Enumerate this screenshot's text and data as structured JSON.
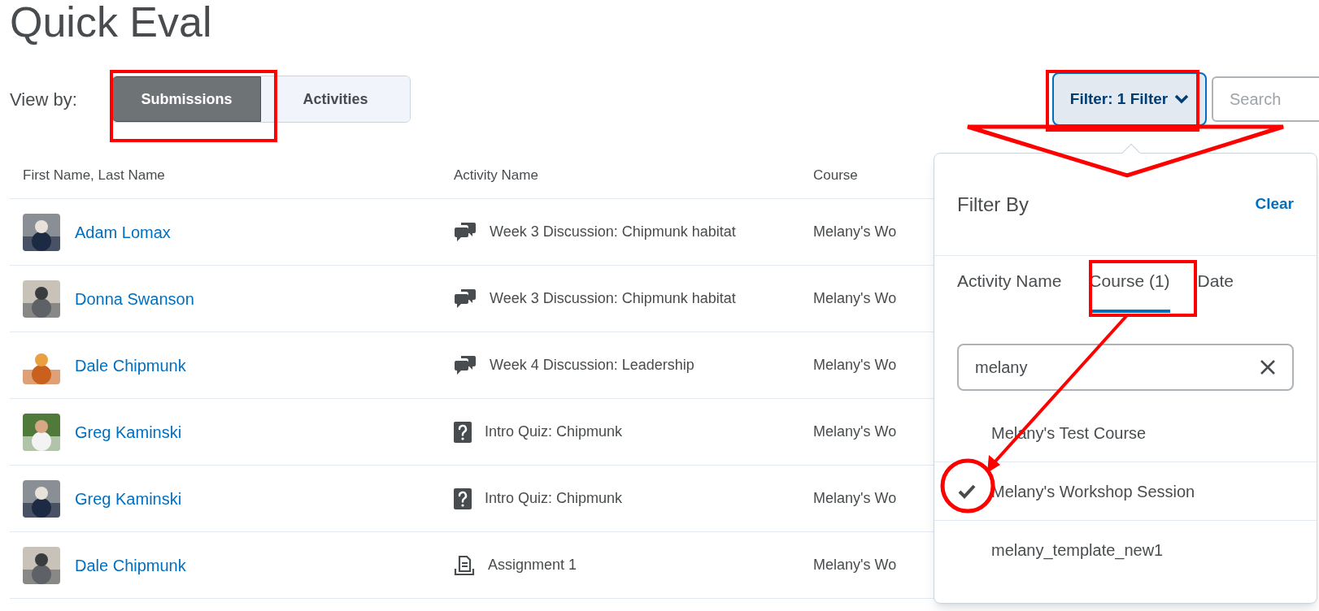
{
  "title": "Quick Eval",
  "view_by": {
    "label": "View by:",
    "options": [
      {
        "label": "Submissions",
        "selected": true
      },
      {
        "label": "Activities",
        "selected": false
      }
    ]
  },
  "filter_button": "Filter: 1 Filter",
  "search": {
    "placeholder": "Search"
  },
  "table": {
    "columns": [
      "First Name, Last Name",
      "Activity Name",
      "Course"
    ],
    "rows": [
      {
        "name": "Adam Lomax",
        "kind": "discussion",
        "activity": "Week 3 Discussion: Chipmunk habitat",
        "course": "Melany's Wo"
      },
      {
        "name": "Donna Swanson",
        "kind": "discussion",
        "activity": "Week 3 Discussion: Chipmunk habitat",
        "course": "Melany's Wo"
      },
      {
        "name": "Dale Chipmunk",
        "kind": "discussion",
        "activity": "Week 4 Discussion: Leadership",
        "course": "Melany's Wo"
      },
      {
        "name": "Greg Kaminski",
        "kind": "quiz",
        "activity": "Intro Quiz: Chipmunk",
        "course": "Melany's Wo"
      },
      {
        "name": "Greg Kaminski",
        "kind": "quiz",
        "activity": "Intro Quiz: Chipmunk",
        "course": "Melany's Wo"
      },
      {
        "name": "Dale Chipmunk",
        "kind": "assignment",
        "activity": "Assignment 1",
        "course": "Melany's Wo"
      }
    ]
  },
  "filter_panel": {
    "title": "Filter By",
    "clear": "Clear",
    "tabs": [
      {
        "label": "Activity Name",
        "selected": false
      },
      {
        "label": "Course (1)",
        "selected": true
      },
      {
        "label": "Date",
        "selected": false
      }
    ],
    "search_value": "melany",
    "options": [
      {
        "label": "Melany's Test Course",
        "checked": false
      },
      {
        "label": "Melany's Workshop Session",
        "checked": true
      },
      {
        "label": "melany_template_new1",
        "checked": false
      }
    ]
  }
}
